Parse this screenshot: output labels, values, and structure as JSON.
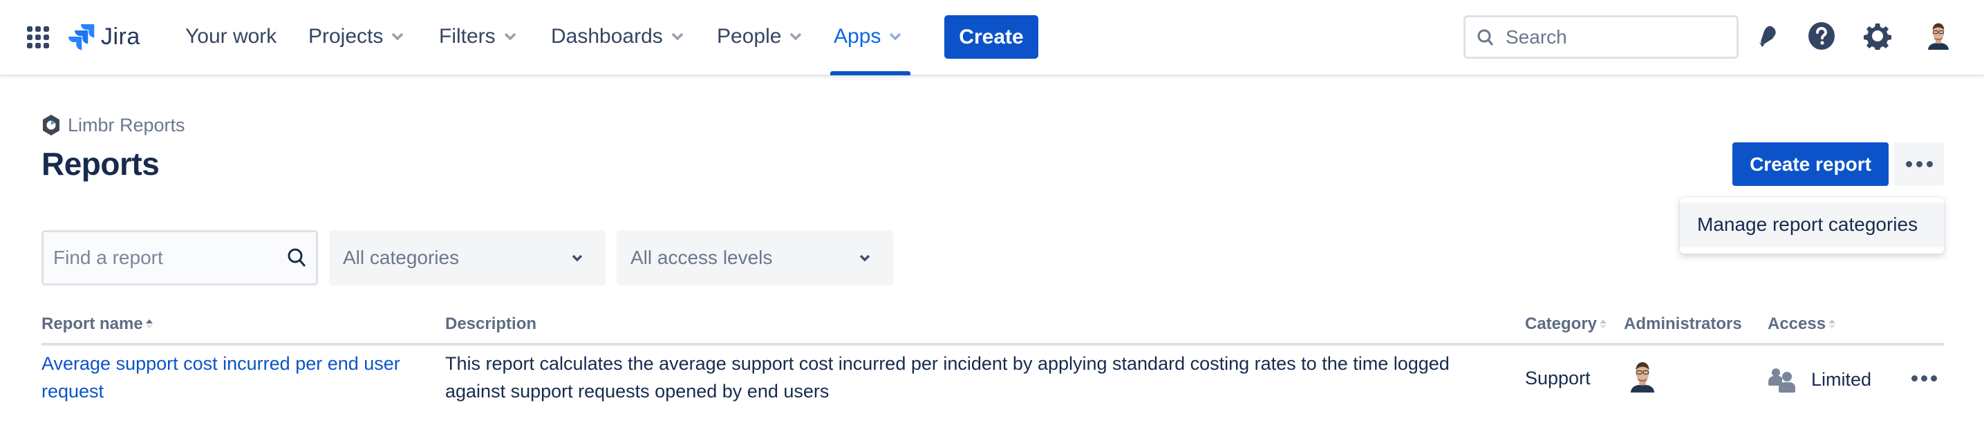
{
  "topnav": {
    "product": "Jira",
    "items": [
      {
        "label": "Your work",
        "dropdown": false,
        "active": false
      },
      {
        "label": "Projects",
        "dropdown": true,
        "active": false
      },
      {
        "label": "Filters",
        "dropdown": true,
        "active": false
      },
      {
        "label": "Dashboards",
        "dropdown": true,
        "active": false
      },
      {
        "label": "People",
        "dropdown": true,
        "active": false
      },
      {
        "label": "Apps",
        "dropdown": true,
        "active": true
      }
    ],
    "create_label": "Create",
    "search_placeholder": "Search",
    "icons": [
      "app-switcher-icon",
      "notifications-bell-icon",
      "help-icon",
      "settings-gear-icon",
      "user-avatar"
    ]
  },
  "page": {
    "breadcrumb": "Limbr Reports",
    "title": "Reports",
    "create_report_label": "Create report",
    "more_menu": {
      "open": true,
      "items": [
        "Manage report categories"
      ]
    }
  },
  "filters": {
    "search_placeholder": "Find a report",
    "category_select": "All categories",
    "access_select": "All access levels"
  },
  "table": {
    "columns": [
      {
        "label": "Report name",
        "sortable": true,
        "sorted": "asc"
      },
      {
        "label": "Description",
        "sortable": false
      },
      {
        "label": "Category",
        "sortable": true
      },
      {
        "label": "Administrators",
        "sortable": false
      },
      {
        "label": "Access",
        "sortable": true
      }
    ],
    "rows": [
      {
        "name": "Average support cost incurred per end user request",
        "description": "This report calculates the average support cost incurred per incident by applying standard costing rates to the time logged against support requests opened by end users",
        "category": "Support",
        "administrators": [
          "user-avatar"
        ],
        "access": "Limited",
        "access_icon": "people-group-icon"
      }
    ]
  },
  "colors": {
    "brand_blue": "#0c53c9",
    "text_primary": "#172b4d",
    "text_subtle": "#6b778c",
    "nav_text": "#344563",
    "active_nav": "#0c66e4"
  }
}
